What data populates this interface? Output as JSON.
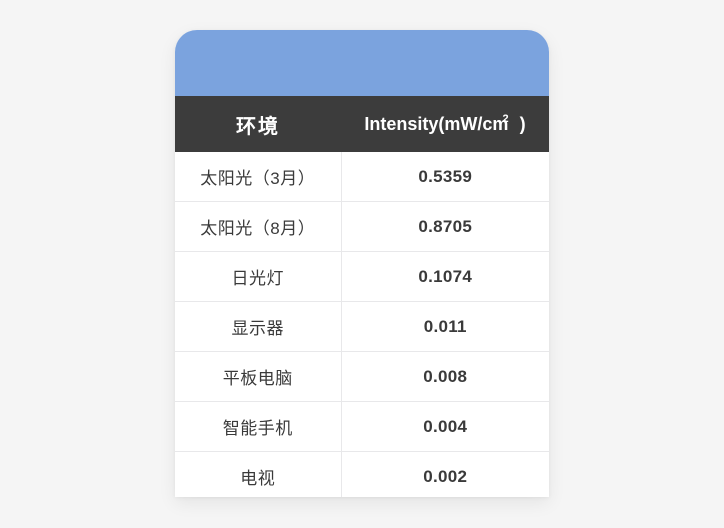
{
  "card": {
    "banner_color": "#7ba3de",
    "header_bg_color": "#3c3c3c",
    "background_color": "#f5f5f5"
  },
  "table": {
    "columns": [
      {
        "key": "environment",
        "label": "环境"
      },
      {
        "key": "intensity",
        "label": "Intensity(mW/cm",
        "superscript": "2",
        "label_tail": " )"
      }
    ],
    "rows": [
      {
        "environment": "太阳光（3月）",
        "intensity": "0.5359"
      },
      {
        "environment": "太阳光（8月）",
        "intensity": "0.8705"
      },
      {
        "environment": "日光灯",
        "intensity": "0.1074"
      },
      {
        "environment": "显示器",
        "intensity": "0.011"
      },
      {
        "environment": "平板电脑",
        "intensity": "0.008"
      },
      {
        "environment": "智能手机",
        "intensity": "0.004"
      },
      {
        "environment": "电视",
        "intensity": "0.002"
      }
    ]
  }
}
